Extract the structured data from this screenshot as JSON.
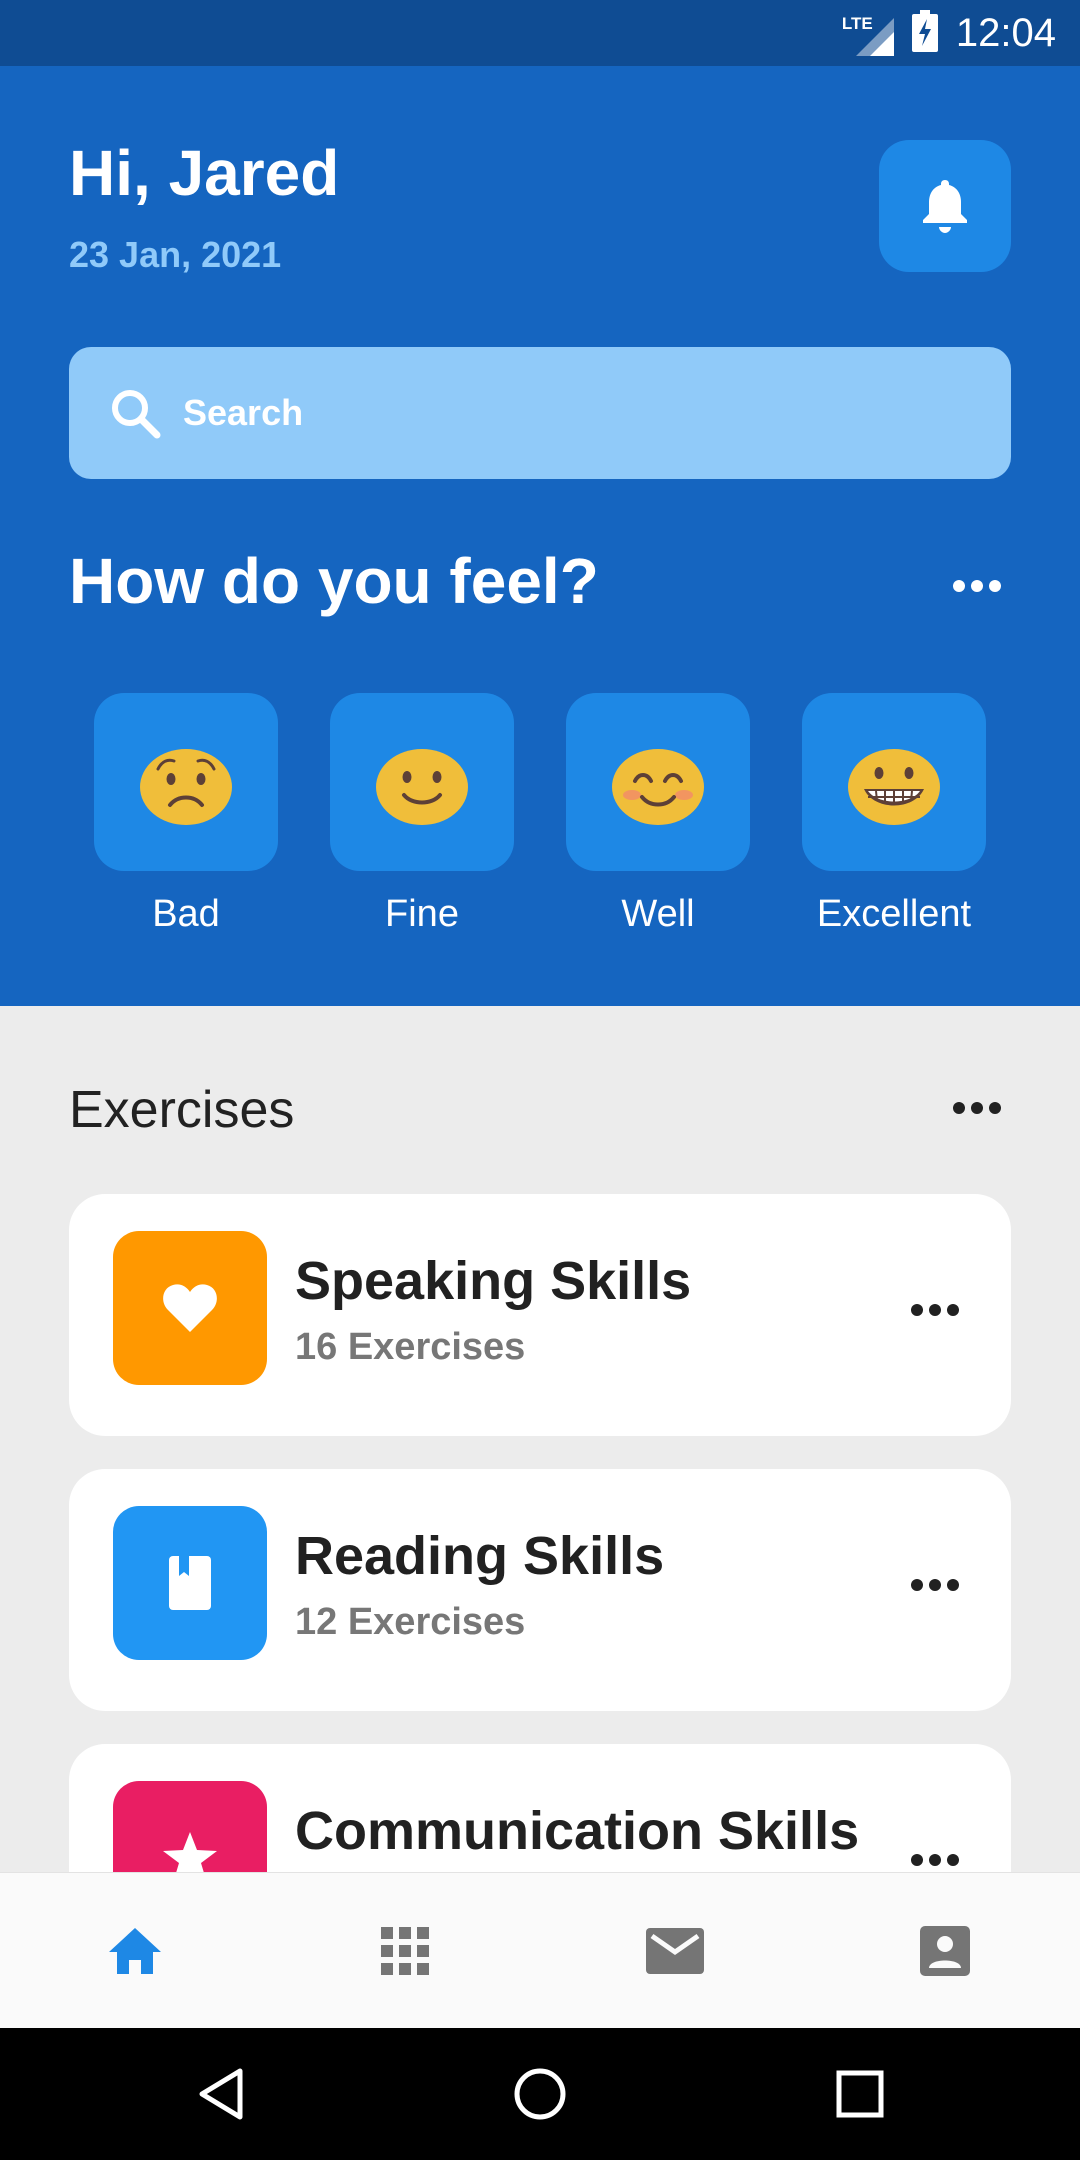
{
  "status_bar": {
    "network": "LTE",
    "time": "12:04"
  },
  "header": {
    "greeting": "Hi, Jared",
    "date": "23 Jan, 2021",
    "search_placeholder": "Search"
  },
  "feel": {
    "title": "How do you feel?",
    "moods": [
      {
        "label": "Bad",
        "icon": "sad-face-icon"
      },
      {
        "label": "Fine",
        "icon": "slight-smile-face-icon"
      },
      {
        "label": "Well",
        "icon": "blush-smile-face-icon"
      },
      {
        "label": "Excellent",
        "icon": "grin-face-icon"
      }
    ]
  },
  "exercises": {
    "title": "Exercises",
    "items": [
      {
        "title": "Speaking Skills",
        "subtitle": "16 Exercises",
        "icon": "heart-icon",
        "color": "#ff9800"
      },
      {
        "title": "Reading Skills",
        "subtitle": "12 Exercises",
        "icon": "book-icon",
        "color": "#2196f3"
      },
      {
        "title": "Communication Skills",
        "subtitle": "",
        "icon": "star-icon",
        "color": "#e91e63"
      }
    ]
  },
  "bottom_nav": [
    "home-icon",
    "apps-grid-icon",
    "mail-icon",
    "contact-icon"
  ],
  "colors": {
    "header_bg": "#1565c0",
    "accent": "#1e88e5",
    "active_nav": "#1e88e5",
    "inactive_nav": "#757575"
  }
}
